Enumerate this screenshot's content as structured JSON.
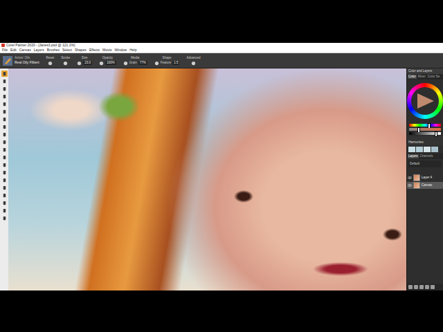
{
  "window": {
    "title": "Corel Painter 2020 - [Janes3.psd @ 121.1%]"
  },
  "menu": [
    "File",
    "Edit",
    "Canvas",
    "Layers",
    "Brushes",
    "Select",
    "Shapes",
    "Effects",
    "Movie",
    "Window",
    "Help"
  ],
  "brush": {
    "category": "Artists' Oils",
    "variant": "Real Oily Filbert"
  },
  "property_bar": [
    {
      "label": "Reset",
      "field": "",
      "value": ""
    },
    {
      "label": "Stroke",
      "field": "",
      "value": ""
    },
    {
      "label": "Size",
      "field": "",
      "value": "23.0"
    },
    {
      "label": "Opacity",
      "field": "",
      "value": "100%"
    },
    {
      "label": "Media",
      "field": "Grain",
      "value": "77%"
    },
    {
      "label": "Shape",
      "field": "Feature",
      "value": "1.5"
    },
    {
      "label": "Advanced",
      "field": "",
      "value": ""
    }
  ],
  "tools": [
    {
      "selected": true
    },
    {
      "selected": false
    },
    {
      "selected": false
    },
    {
      "selected": false
    },
    {
      "selected": false
    },
    {
      "selected": false
    },
    {
      "selected": false
    },
    {
      "selected": false
    },
    {
      "selected": false
    },
    {
      "selected": false
    },
    {
      "selected": false
    },
    {
      "selected": false
    },
    {
      "selected": false
    },
    {
      "selected": false
    },
    {
      "selected": false
    },
    {
      "selected": false
    },
    {
      "selected": false
    },
    {
      "selected": false
    },
    {
      "selected": false
    },
    {
      "selected": false
    }
  ],
  "panel": {
    "title": "Color and Layers",
    "color_tabs": [
      {
        "label": "Color",
        "selected": true
      },
      {
        "label": "Mixer",
        "selected": false
      },
      {
        "label": "Color Se",
        "selected": false
      }
    ],
    "sliders": [
      {
        "name": "hue",
        "level": 0.62
      },
      {
        "name": "saturation",
        "level": 0.3
      },
      {
        "name": "value",
        "level": 0.85
      }
    ],
    "harmonies": "Harmonies",
    "layer_tabs": [
      {
        "label": "Layers",
        "selected": true
      },
      {
        "label": "Channels",
        "selected": false
      }
    ],
    "composite": "Default",
    "layers": [
      {
        "name": "Layer 4",
        "selected": false,
        "visible": true
      },
      {
        "name": "Canvas",
        "selected": true,
        "visible": true
      }
    ]
  }
}
